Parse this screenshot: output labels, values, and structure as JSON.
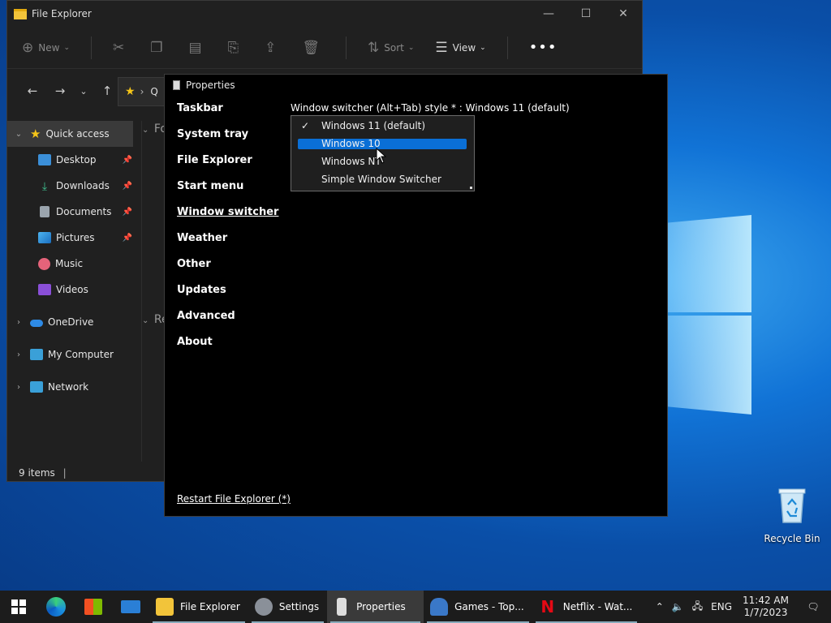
{
  "desktop": {
    "recycle_bin_label": "Recycle Bin"
  },
  "explorer": {
    "title": "File Explorer",
    "toolbar": {
      "new_label": "New",
      "sort_label": "Sort",
      "view_label": "View",
      "more_label": "•••"
    },
    "address_glyph": "Q",
    "sidebar": {
      "quick_access": "Quick access",
      "desktop": "Desktop",
      "downloads": "Downloads",
      "documents": "Documents",
      "pictures": "Pictures",
      "music": "Music",
      "videos": "Videos",
      "onedrive": "OneDrive",
      "my_computer": "My Computer",
      "network": "Network"
    },
    "main_heading_1": "Fo",
    "main_heading_2": "Re",
    "status": "9 items"
  },
  "properties": {
    "title": "Properties",
    "nav": {
      "taskbar": "Taskbar",
      "system_tray": "System tray",
      "file_explorer": "File Explorer",
      "start_menu": "Start menu",
      "window_switcher": "Window switcher",
      "weather": "Weather",
      "other": "Other",
      "updates": "Updates",
      "advanced": "Advanced",
      "about": "About"
    },
    "setting_label": "Window switcher (Alt+Tab) style * : Windows 11 (default)",
    "dropdown": {
      "options": [
        "Windows 11 (default)",
        "Windows 10",
        "Windows NT",
        "Simple Window Switcher"
      ],
      "checked": "Windows 11 (default)",
      "highlighted": "Windows 10"
    },
    "restart_link": "Restart File Explorer (*)"
  },
  "taskbar": {
    "apps": {
      "file_explorer": "File Explorer",
      "settings": "Settings",
      "properties": "Properties",
      "games": "Games - Top...",
      "netflix": "Netflix - Wat..."
    },
    "language": "ENG",
    "time": "11:42 AM",
    "date": "1/7/2023"
  },
  "colors": {
    "accent": "#0a6fd6",
    "desktop_blue": "#1173d6",
    "window_bg": "#202020"
  }
}
